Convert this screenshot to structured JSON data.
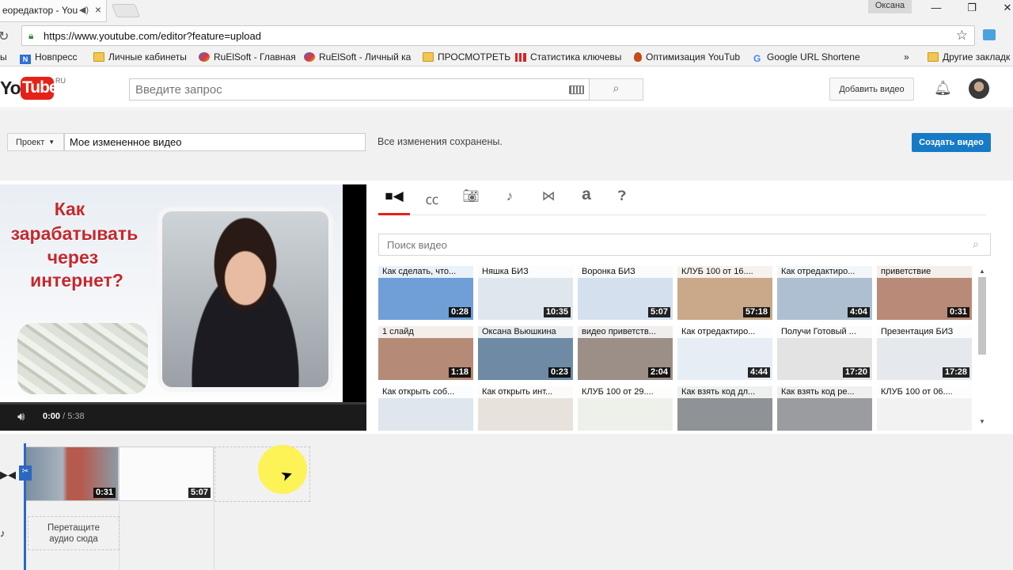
{
  "browser": {
    "tab_title": "еоредактор - You",
    "tab_audio_icon": "speaker-icon",
    "user_name": "Оксана",
    "url": "https://www.youtube.com/editor?feature=upload",
    "window_controls": [
      "minimize",
      "restore",
      "close"
    ]
  },
  "bookmarks": {
    "items": [
      {
        "label": "ы"
      },
      {
        "label": "Новпресс",
        "icon": "n-icon",
        "color": "#2f6fd6"
      },
      {
        "label": "Личные кабинеты",
        "icon": "folder-icon"
      },
      {
        "label": "RuElSoft - Главная",
        "icon": "globe-icon"
      },
      {
        "label": "RuElSoft - Личный ка",
        "icon": "globe-icon"
      },
      {
        "label": "ПРОСМОТРЕТЬ",
        "icon": "folder-icon"
      },
      {
        "label": "Статистика ключевы",
        "icon": "bars-icon"
      },
      {
        "label": "Оптимизация YouTub",
        "icon": "flame-icon"
      },
      {
        "label": "Google URL Shortene",
        "icon": "google-icon"
      }
    ],
    "overflow": "»",
    "other": "Другие закладк"
  },
  "header": {
    "logo_you": "You",
    "logo_tube": "Tube",
    "logo_region": "RU",
    "search_placeholder": "Введите запрос",
    "upload_label": "Добавить видео"
  },
  "editor": {
    "project_label": "Проект",
    "title_value": "Мое измененное видео",
    "status": "Все изменения сохранены.",
    "create_label": "Создать видео"
  },
  "player": {
    "thumbnail_lines": [
      "Как",
      "зарабатывать",
      "через",
      "интернет?"
    ],
    "current_time": "0:00",
    "duration": "/ 5:38"
  },
  "panel": {
    "tabs": [
      "video-camera-icon",
      "cc-icon",
      "photo-camera-icon",
      "music-note-icon",
      "transitions-icon",
      "text-icon",
      "help-icon"
    ],
    "active_tab": 0,
    "search_placeholder": "Поиск видео",
    "videos": [
      {
        "title": "Как сделать, что...",
        "duration": "0:28",
        "color": "#6f9fd6"
      },
      {
        "title": "Няшка БИЗ",
        "duration": "10:35",
        "color": "#dfe6ee"
      },
      {
        "title": "Воронка БИЗ",
        "duration": "5:07",
        "color": "#d4e0ee"
      },
      {
        "title": "КЛУБ 100 от 16....",
        "duration": "57:18",
        "color": "#c9a98a"
      },
      {
        "title": "Как отредактиро...",
        "duration": "4:04",
        "color": "#aebfd1"
      },
      {
        "title": "приветствие",
        "duration": "0:31",
        "color": "#b98a78"
      },
      {
        "title": "1 слайд",
        "duration": "1:18",
        "color": "#b58a76"
      },
      {
        "title": "Оксана Вьюшкина",
        "duration": "0:23",
        "color": "#6e8aa4"
      },
      {
        "title": "видео приветств...",
        "duration": "2:04",
        "color": "#9b8f88"
      },
      {
        "title": "Как отредактиро...",
        "duration": "4:44",
        "color": "#e7edf4"
      },
      {
        "title": "Получи Готовый ...",
        "duration": "17:20",
        "color": "#e3e3e3"
      },
      {
        "title": "Презентация БИЗ",
        "duration": "17:28",
        "color": "#e5e8ec"
      },
      {
        "title": "Как открыть соб...",
        "duration": "",
        "color": "#dfe6ee"
      },
      {
        "title": "Как открыть инт...",
        "duration": "",
        "color": "#e8e2dc"
      },
      {
        "title": "КЛУБ 100 от 29....",
        "duration": "",
        "color": "#eef1ea"
      },
      {
        "title": "Как взять код дл...",
        "duration": "",
        "color": "#8f9296"
      },
      {
        "title": "Как взять код ре...",
        "duration": "",
        "color": "#9a9ca0"
      },
      {
        "title": "КЛУБ 100 от 06....",
        "duration": "",
        "color": "#f2f2f2"
      }
    ]
  },
  "timeline": {
    "clips": [
      {
        "duration": "0:31"
      },
      {
        "duration": "5:07"
      }
    ],
    "audio_drop_line1": "Перетащите",
    "audio_drop_line2": "аудио сюда"
  }
}
